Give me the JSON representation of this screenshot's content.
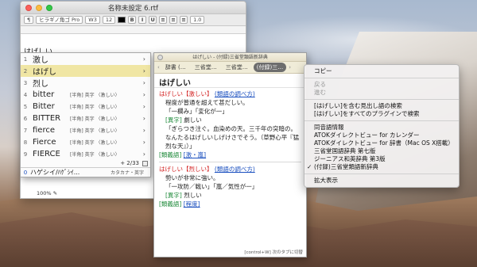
{
  "window": {
    "title": "名称未設定 6.rtf",
    "font_family": "ヒラギノ角ゴ Pro",
    "font_weight": "W3",
    "font_size": "12",
    "bold": "B",
    "italic": "I",
    "underline": "U",
    "line_spacing": "1.0",
    "input_text": "はげしい",
    "zoom": "100%"
  },
  "candidates": {
    "items": [
      {
        "num": "1",
        "word": "激し",
        "note": "",
        "arrow": "›"
      },
      {
        "num": "2",
        "word": "はげし",
        "note": "",
        "arrow": "›"
      },
      {
        "num": "3",
        "word": "烈し",
        "note": "",
        "arrow": "›"
      },
      {
        "num": "4",
        "word": "bitter",
        "note": "[半角] 英字 〈激しい〉",
        "arrow": "›"
      },
      {
        "num": "5",
        "word": "Bitter",
        "note": "[半角] 英字 〈激しい〉",
        "arrow": "›"
      },
      {
        "num": "6",
        "word": "BITTER",
        "note": "[半角] 英字 〈激しい〉",
        "arrow": "›"
      },
      {
        "num": "7",
        "word": "fierce",
        "note": "[半角] 英字 〈激しい〉",
        "arrow": "›"
      },
      {
        "num": "8",
        "word": "Fierce",
        "note": "[半角] 英字 〈激しい〉",
        "arrow": "›"
      },
      {
        "num": "9",
        "word": "FIERCE",
        "note": "[半角] 英字 〈激しい〉",
        "arrow": "›"
      }
    ],
    "page": "+ 2/33",
    "bottom": {
      "num": "0",
      "word": "ハゲシイ/ﾊｹﾞｼｲ...",
      "note": "カタカナ・英字"
    }
  },
  "dictionary": {
    "title": "はげしい - (付録)三省堂類語新辞典",
    "tabs": [
      "辞書 (…",
      "三省堂…",
      "三省堂…",
      "(付録)三…"
    ],
    "headword": "はげしい",
    "entry1": {
      "title": "はげしい【激しい】",
      "link": "(類語の調べ方)",
      "def": "程度が普通を超えて甚だしい。",
      "ex1": "「一欄み」「変化が一」",
      "label_alt": "[異字]",
      "alt": "劇しい",
      "ex2": "「ぎらつき注ぐ。血染めの天。三千年の突暗の。なんたるはげしいしげけさでそう。（草野心平『猛烈な天』）」",
      "syn_label": "[類義語]",
      "syn_link": "[激・嵐]"
    },
    "entry2": {
      "title": "はげしい【烈しい】",
      "link": "(類語の調べ方)",
      "def": "勢いが非常に強い。",
      "ex1": "「一攻防／戦い」「嵐／気性が一」",
      "label_alt": "[異字]",
      "alt": "烈しい",
      "syn_label": "[類義語]",
      "syn_link": "[程度]"
    },
    "footer": "[control+W] 次のタブに切替"
  },
  "context_menu": {
    "items": [
      {
        "label": "コピー",
        "disabled": false,
        "checked": false
      },
      {
        "sep": true
      },
      {
        "label": "戻る",
        "disabled": true,
        "checked": false
      },
      {
        "label": "進む",
        "disabled": true,
        "checked": false
      },
      {
        "sep": true
      },
      {
        "label": "[はげしい]を含む見出し語の検索",
        "disabled": false,
        "checked": false
      },
      {
        "label": "[はげしい]をすべてのプラグインで検索",
        "disabled": false,
        "checked": false
      },
      {
        "sep": true
      },
      {
        "label": "同音語情報",
        "disabled": false,
        "checked": false
      },
      {
        "label": "ATOKダイレクトビュー for カレンダー",
        "disabled": false,
        "checked": false
      },
      {
        "label": "ATOKダイレクトビュー for 辞書（Mac OS X搭載）",
        "disabled": false,
        "checked": false
      },
      {
        "label": "三省堂国語辞典 第七版",
        "disabled": false,
        "checked": false
      },
      {
        "label": "ジーニアス和英辞典 第3版",
        "disabled": false,
        "checked": false
      },
      {
        "label": "(付録)三省堂類語新辞典",
        "disabled": false,
        "checked": true
      },
      {
        "sep": true
      },
      {
        "label": "拡大表示",
        "disabled": false,
        "checked": false
      }
    ]
  },
  "colors": {
    "selection": "#f0e6a4",
    "entry_title": "#d21d1d",
    "link": "#1a4fbf",
    "label": "#1e8a3a"
  },
  "icons": {
    "close": "close-icon",
    "minimize": "minimize-icon",
    "maximize": "maximize-icon",
    "chevron": "chevron-right-icon",
    "checkmark": "checkmark-icon",
    "pencil": "pencil-icon"
  }
}
